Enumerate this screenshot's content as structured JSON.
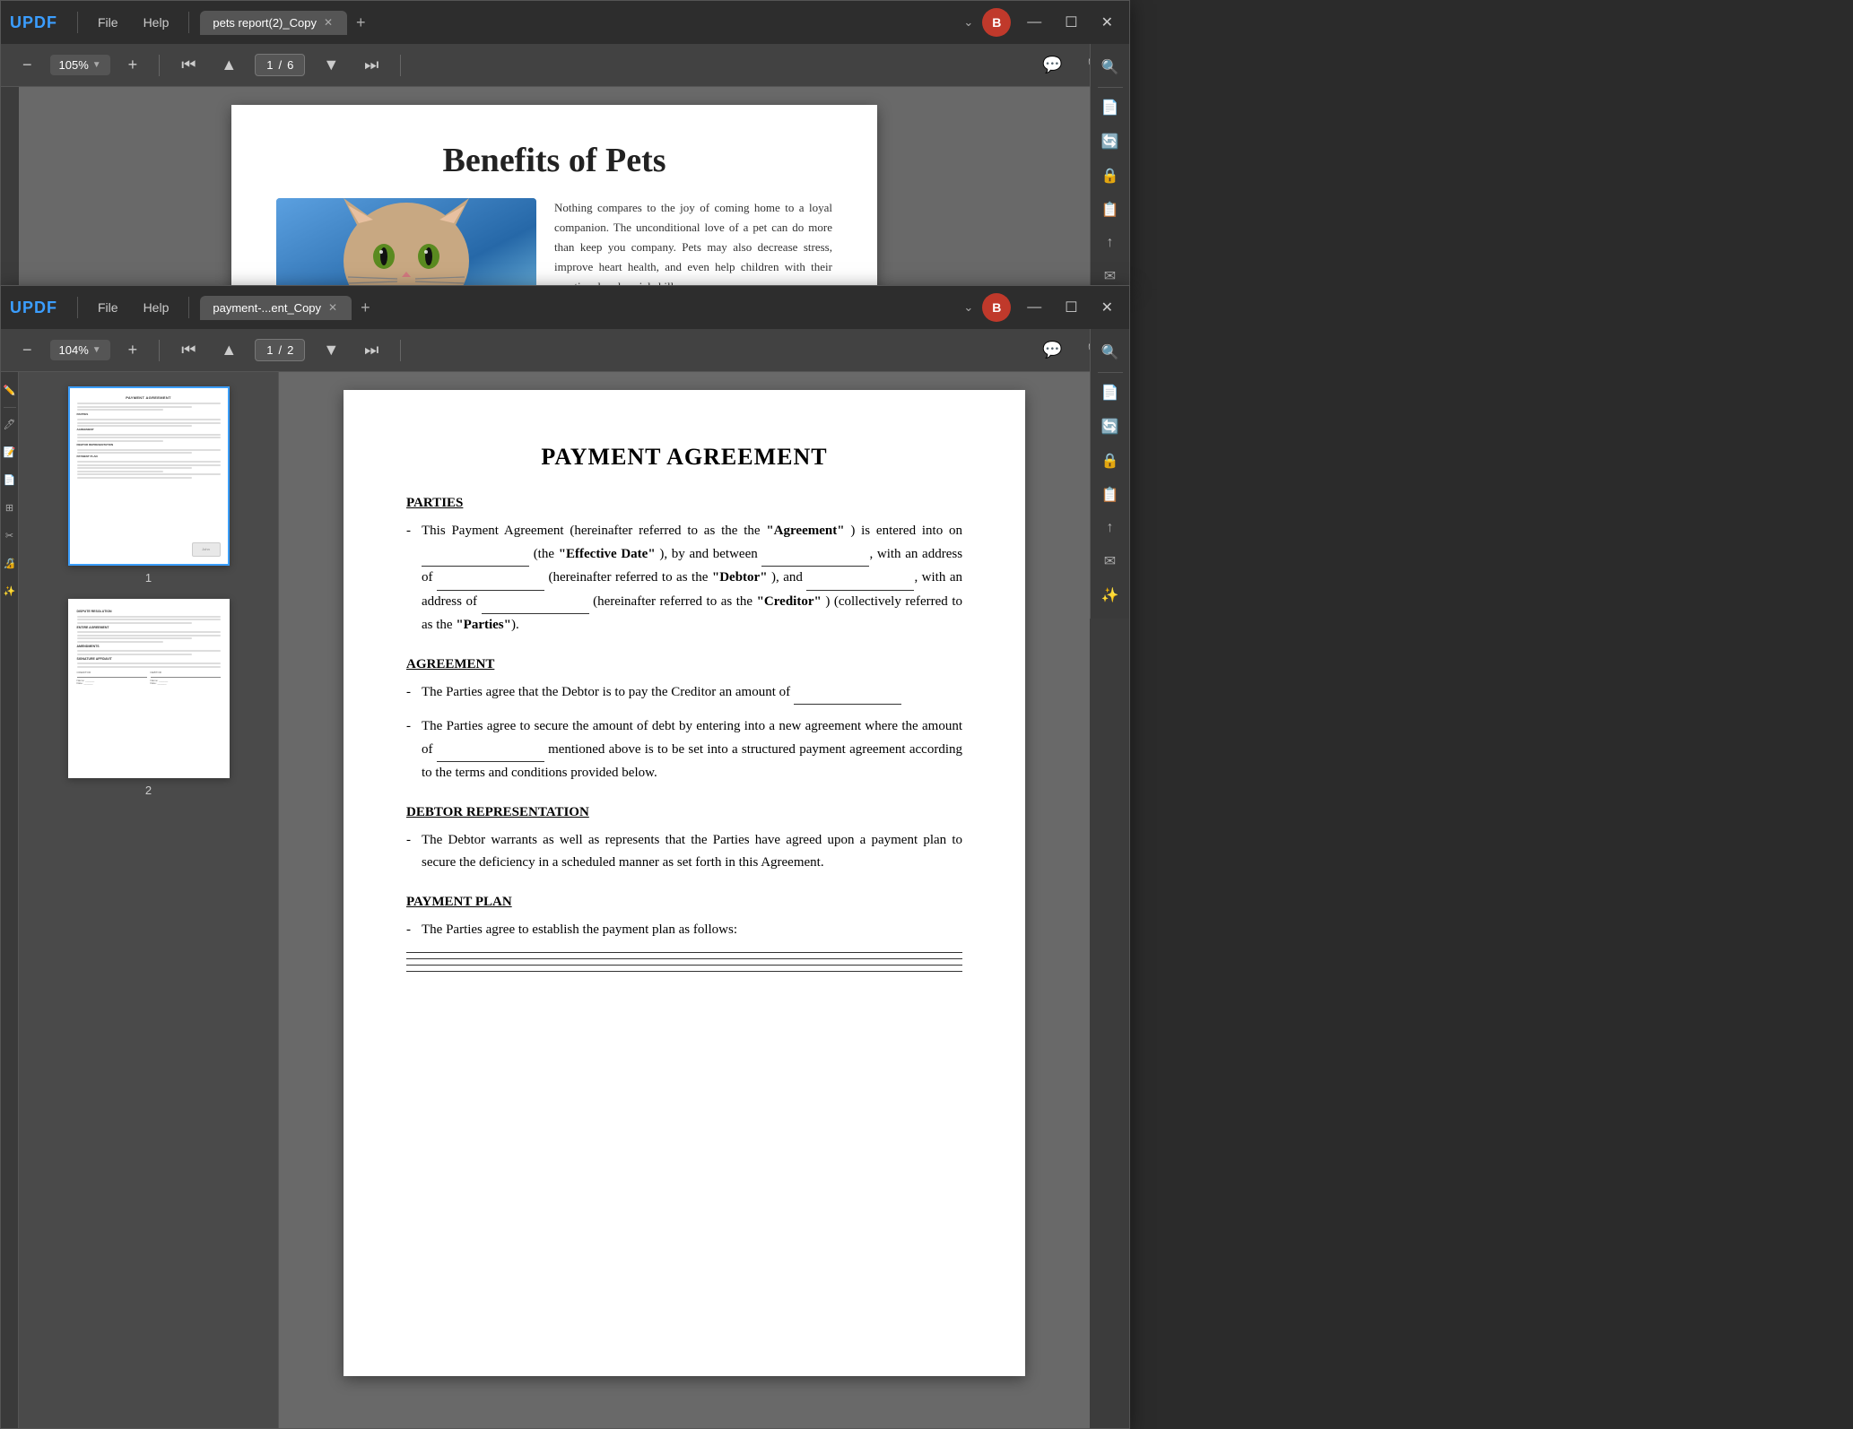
{
  "app": {
    "logo": "UPDF",
    "menu": [
      "File",
      "Help"
    ]
  },
  "top_window": {
    "tab_label": "pets report(2)_Copy",
    "zoom": "105%",
    "page_current": "1",
    "page_total": "6",
    "pdf": {
      "title": "Benefits of Pets",
      "body": "Nothing compares to the joy of coming home to a loyal companion. The unconditional love of a pet can do more than keep you company. Pets may also decrease stress, improve heart health, and even help children with their emotional and social skills."
    }
  },
  "bottom_window": {
    "tab_label": "payment-...ent_Copy",
    "zoom": "104%",
    "page_current": "1",
    "page_total": "2",
    "pdf": {
      "title": "PAYMENT AGREEMENT",
      "sections": {
        "parties": {
          "heading": "PARTIES",
          "text1": "This Payment Agreement (hereinafter referred to as the",
          "agreement_term": "\"Agreement\"",
          "text2": ") is entered into on",
          "text3": "(the",
          "effective_date": "\"Effective Date\"",
          "text4": "), by and between",
          "text5": ", with an address of",
          "debtor_term": "\"Debtor\"",
          "text6": "), and",
          "text7": ", with an address of",
          "creditor_term": "\"Creditor\"",
          "text8": ") (collectively referred to as the",
          "parties_term": "\"Parties\""
        },
        "agreement": {
          "heading": "AGREEMENT",
          "bullet1": "The Parties agree that the Debtor is to pay the Creditor an amount of",
          "bullet2": "The Parties agree to secure the amount of debt by entering into a new agreement where the amount of",
          "bullet2b": "mentioned above is to be set into a structured payment agreement according to the terms and conditions provided below."
        },
        "debtor_rep": {
          "heading": "DEBTOR REPRESENTATION",
          "text": "The Debtor warrants as well as represents that the Parties have agreed upon a payment plan to secure the deficiency in a scheduled manner as set forth in this Agreement."
        },
        "payment_plan": {
          "heading": "PAYMENT PLAN",
          "text": "The Parties agree to establish the payment plan as follows:"
        }
      }
    }
  }
}
